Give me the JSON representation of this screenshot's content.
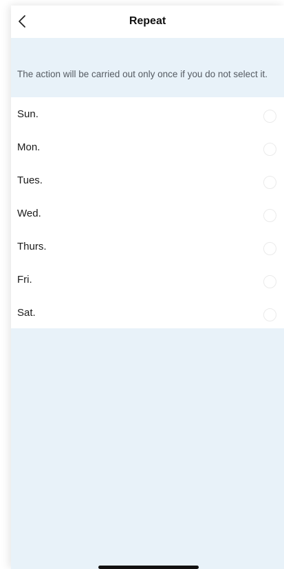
{
  "header": {
    "back_icon": "chevron-left-icon",
    "title": "Repeat"
  },
  "hint": "The action will be carried out only once if you do not select it.",
  "days": [
    {
      "label": "Sun.",
      "selected": false
    },
    {
      "label": "Mon.",
      "selected": false
    },
    {
      "label": "Tues.",
      "selected": false
    },
    {
      "label": "Wed.",
      "selected": false
    },
    {
      "label": "Thurs.",
      "selected": false
    },
    {
      "label": "Fri.",
      "selected": false
    },
    {
      "label": "Sat.",
      "selected": false
    }
  ],
  "colors": {
    "page_background": "#e8f2f9",
    "list_background": "#ffffff",
    "title_text": "#111111",
    "hint_text": "#555b62"
  }
}
